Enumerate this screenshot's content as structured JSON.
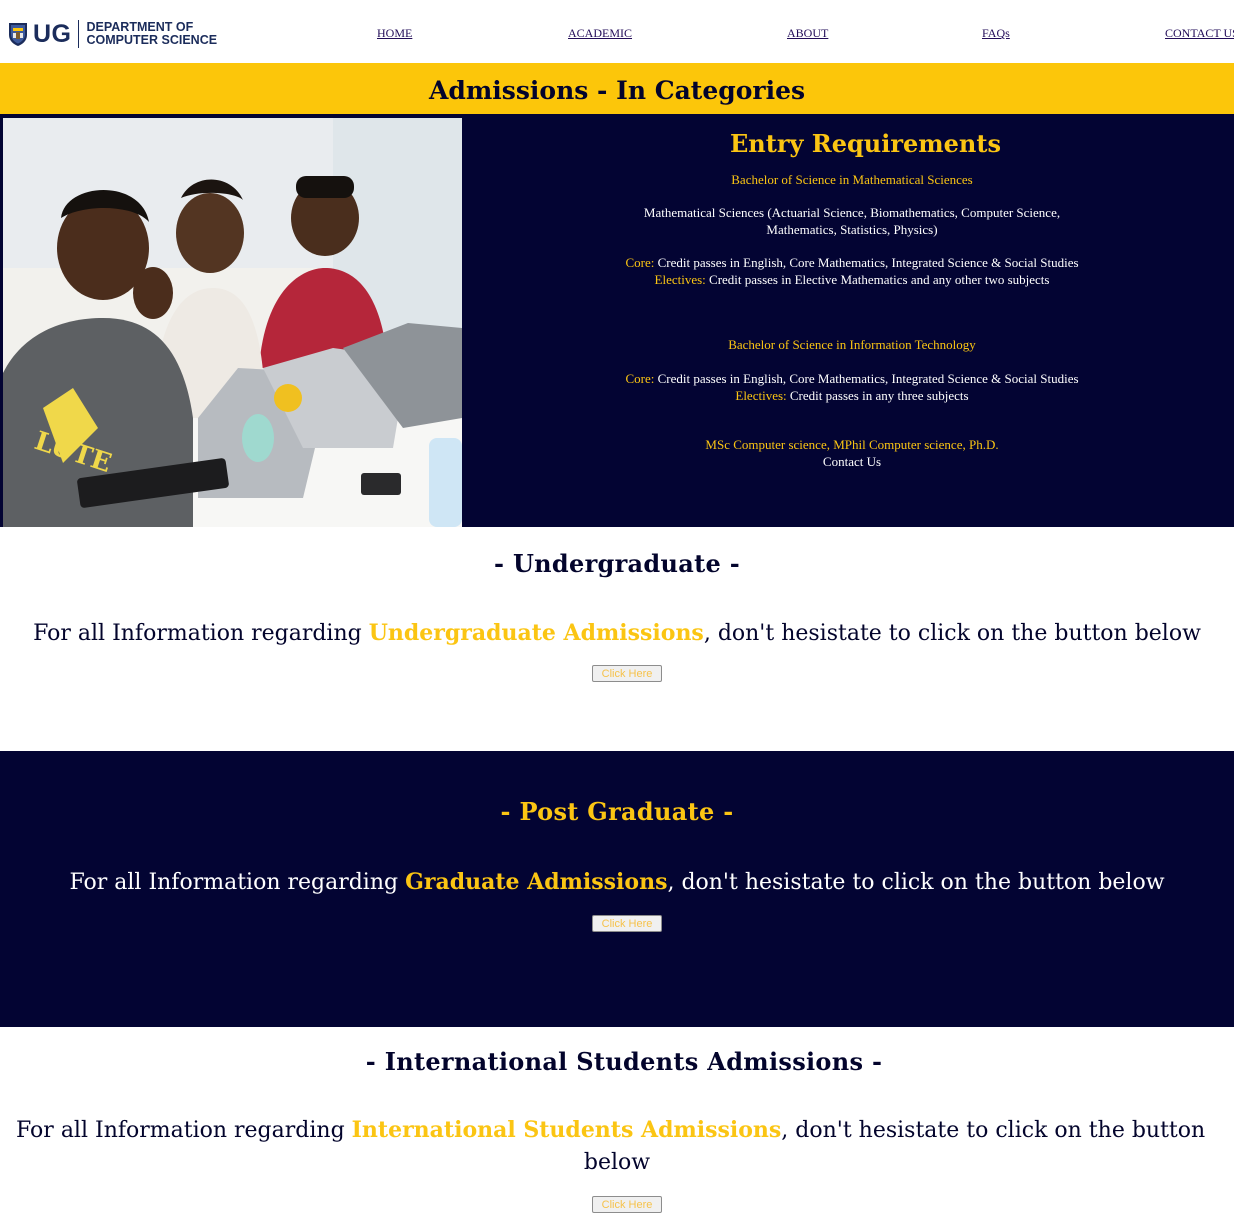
{
  "header": {
    "logo_ug": "UG",
    "logo_line1": "DEPARTMENT OF",
    "logo_line2": "COMPUTER SCIENCE",
    "nav": {
      "home": "HOME",
      "academic": "ACADEMIC",
      "about": "ABOUT",
      "faqs": "FAQs",
      "contact": "CONTACT US"
    }
  },
  "banner": {
    "title": "Admissions - In Categories"
  },
  "entry": {
    "title": "Entry Requirements",
    "bsc_math": {
      "heading": "Bachelor of Science in Mathematical Sciences",
      "programs_line1": "Mathematical Sciences (Actuarial Science, Biomathematics, Computer Science,",
      "programs_line2": "Mathematics, Statistics, Physics)",
      "core_label": "Core:",
      "core_text": " Credit passes in English, Core Mathematics, Integrated Science & Social Studies",
      "electives_label": "Electives:",
      "electives_text": " Credit passes in Elective Mathematics and any other two subjects"
    },
    "bsc_it": {
      "heading": "Bachelor of Science in Information Technology",
      "core_label": "Core:",
      "core_text": " Credit passes in English, Core Mathematics, Integrated Science & Social Studies",
      "electives_label": "Electives:",
      "electives_text": " Credit passes in any three subjects"
    },
    "grad_programs": "MSc Computer science, MPhil Computer science, Ph.D.",
    "contact": "Contact Us"
  },
  "undergraduate": {
    "title": "- Undergraduate -",
    "text_prefix": "For all Information regarding ",
    "highlight": "Undergraduate Admissions",
    "text_suffix": ", don't hesistate to click on the button below",
    "button": "Click Here"
  },
  "postgraduate": {
    "title": "- Post Graduate -",
    "text_prefix": "For all Information regarding ",
    "highlight": "Graduate Admissions",
    "text_suffix": ", don't hesistate to click on the button below",
    "button": "Click Here"
  },
  "international": {
    "title": "- International Students Admissions -",
    "text_prefix": "For all Information regarding ",
    "highlight": "International Students Admissions",
    "text_suffix": ", don't hesistate to click on the button",
    "text_line2": "below",
    "button": "Click Here"
  },
  "colors": {
    "navy": "#030433",
    "gold": "#fcc60a",
    "accent_text": "#fbc513"
  }
}
